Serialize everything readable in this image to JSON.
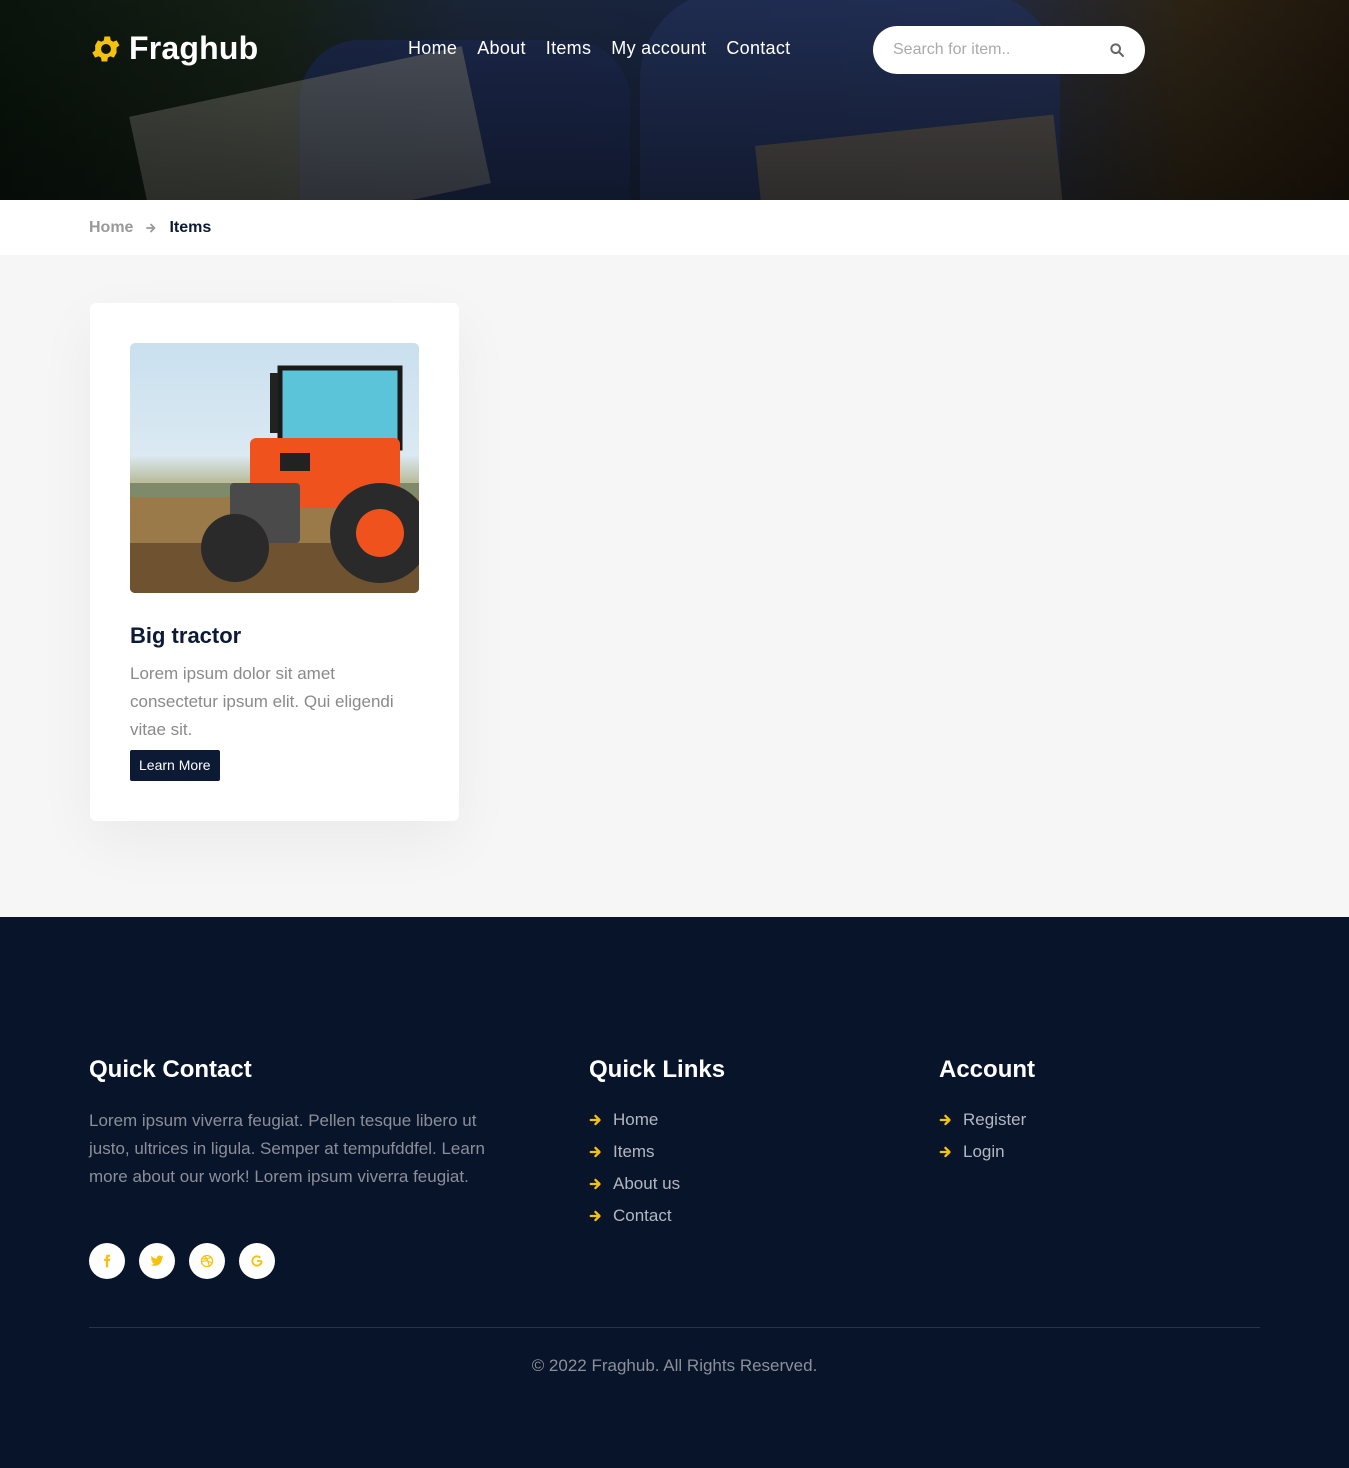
{
  "brand": {
    "name": "Fraghub",
    "accent": "#f5c10e",
    "dark": "#07142a"
  },
  "header": {
    "nav": [
      "Home",
      "About",
      "Items",
      "My account",
      "Contact"
    ],
    "search": {
      "placeholder": "Search for item..",
      "value": ""
    }
  },
  "breadcrumb": {
    "home": "Home",
    "current": "Items"
  },
  "items": [
    {
      "title": "Big tractor",
      "description": "Lorem ipsum dolor sit amet consectetur ipsum elit. Qui eligendi vitae sit.",
      "button": "Learn More",
      "image": "tractor-photo"
    }
  ],
  "footer": {
    "quick_contact": {
      "heading": "Quick Contact",
      "text": "Lorem ipsum viverra feugiat. Pellen tesque libero ut justo, ultrices in ligula. Semper at tempufddfel. Learn more about our work! Lorem ipsum viverra feugiat.",
      "socials": [
        "facebook-icon",
        "twitter-icon",
        "dribbble-icon",
        "google-icon"
      ]
    },
    "quick_links": {
      "heading": "Quick Links",
      "items": [
        "Home",
        "Items",
        "About us",
        "Contact"
      ]
    },
    "account": {
      "heading": "Account",
      "items": [
        "Register",
        "Login"
      ]
    },
    "copyright": "© 2022 Fraghub. All Rights Reserved."
  }
}
